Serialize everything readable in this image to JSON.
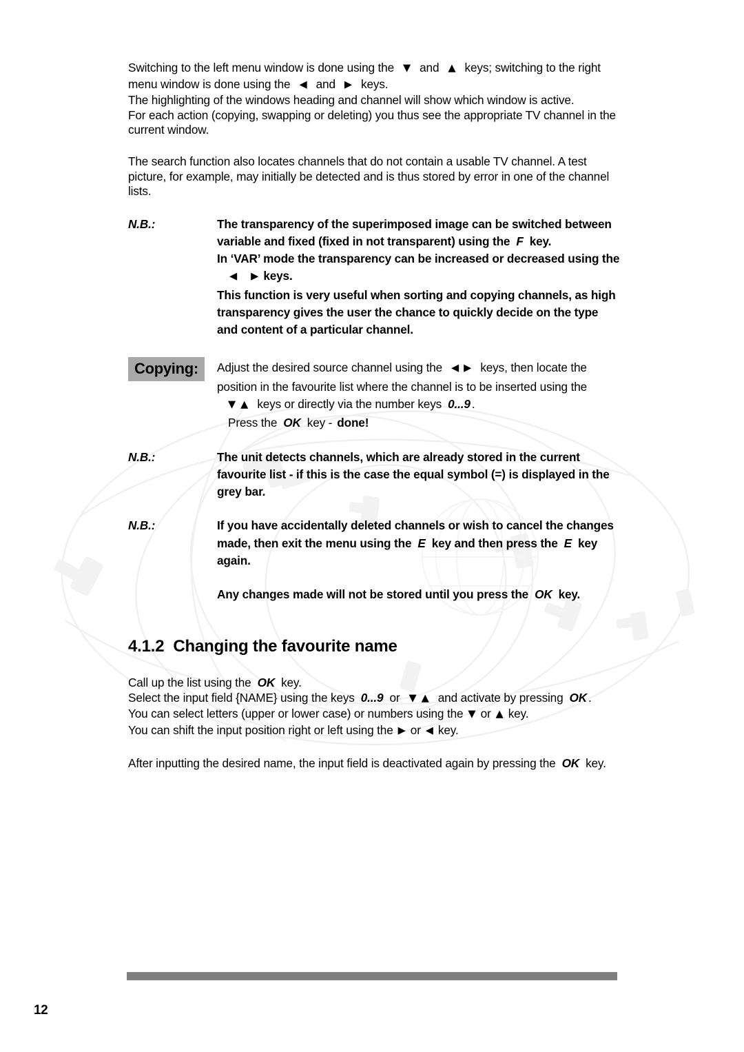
{
  "document": {
    "page_number": "12",
    "footer_bar_color": "#808080",
    "highlight_color": "#a8a8a8"
  },
  "intro": {
    "p1": {
      "l1a": "Switching to the left menu window is done using the",
      "l1_arrow1": "▼",
      "l1b": "and",
      "l1_arrow2": "▲",
      "l1c": "keys; switching to the right",
      "l2a": "menu window is done using the",
      "l2_arrow1": "◀",
      "l2b": "and",
      "l2_arrow2": "▶",
      "l2c": "keys.",
      "l3": "The highlighting of the windows heading and channel will show which window is active.",
      "l4": "For each action (copying, swapping or deleting) you thus see the appropriate TV channel in the",
      "l5": "current window."
    },
    "p2": {
      "l1": "The search function also locates channels that do not contain a usable TV channel. A test",
      "l2": "picture, for example, may initially be detected and is thus stored by error in one of the channel",
      "l3": "lists."
    }
  },
  "nb1": {
    "label": "N.B.:",
    "l1": "The transparency of the superimposed image can be switched between",
    "l2a": "variable and fixed (fixed in not transparent) using the",
    "l2_key": "F",
    "l2b": "key.",
    "l3": "In ‘VAR’ mode the transparency can be increased or decreased using the",
    "l4_arrow1": "◀",
    "l4_arrow2": "▶",
    "l4b": "keys.",
    "l5": "This function is very useful when sorting and copying channels, as high",
    "l6": "transparency gives the user the chance to quickly decide on the type",
    "l7": "and content of a particular channel."
  },
  "copying": {
    "tag": "Copying:",
    "l1a": "Adjust the desired source channel using the",
    "l1_arrow1": "◀",
    "l1_arrow2": "▶",
    "l1b": "keys, then locate the",
    "l2": "position in the favourite list where the channel is to be inserted using the",
    "l3_arrow1": "▼",
    "l3_arrow2": "▲",
    "l3a": "keys or directly via the number keys",
    "l3_key": "0...9",
    "l3b": ".",
    "l4a": "Press the",
    "l4_key": "OK",
    "l4b": "key -",
    "l4_done": "done!"
  },
  "nb2": {
    "label": "N.B.:",
    "l1": "The unit detects channels, which are already stored in the current",
    "l2": "favourite list - if this is the case the equal  symbol (=) is displayed in the",
    "l3": "grey bar."
  },
  "nb3": {
    "label": "N.B.:",
    "l1": "If you have accidentally deleted channels or wish to cancel the changes",
    "l2a": "made, then exit the menu using the",
    "l2_key1": "E",
    "l2b": "key and then press the",
    "l2_key2": "E",
    "l2c": "key",
    "l3": "again."
  },
  "nb_note": {
    "l1a": "Any changes made will not be stored until you press the",
    "l1_key": "OK",
    "l1b": "key."
  },
  "section": {
    "number": "4.1.2",
    "title": "Changing the favourite name"
  },
  "body": {
    "l1a": "Call up the list using the",
    "l1_key": "OK",
    "l1b": "key.",
    "l2a": "Select the input field {NAME} using the keys",
    "l2_key": "0...9",
    "l2b": "or",
    "l2_arrow1": "▼",
    "l2_arrow2": "▲",
    "l2c": "and activate by pressing",
    "l2_key2": "OK",
    "l2d": ".",
    "l3a": "You can select letters (upper or lower case) or numbers using the",
    "l3_arrow1": "▼",
    "l3b": "or",
    "l3_arrow2": "▲",
    "l3c": "key.",
    "l4a": "You can shift the input position right or left using the",
    "l4_arrow1": "▶",
    "l4b": "or",
    "l4_arrow2": "◀",
    "l4c": "key.",
    "l5a": "After inputting the desired name, the input field is deactivated again by pressing the",
    "l5_key": "OK",
    "l5b": "key."
  }
}
